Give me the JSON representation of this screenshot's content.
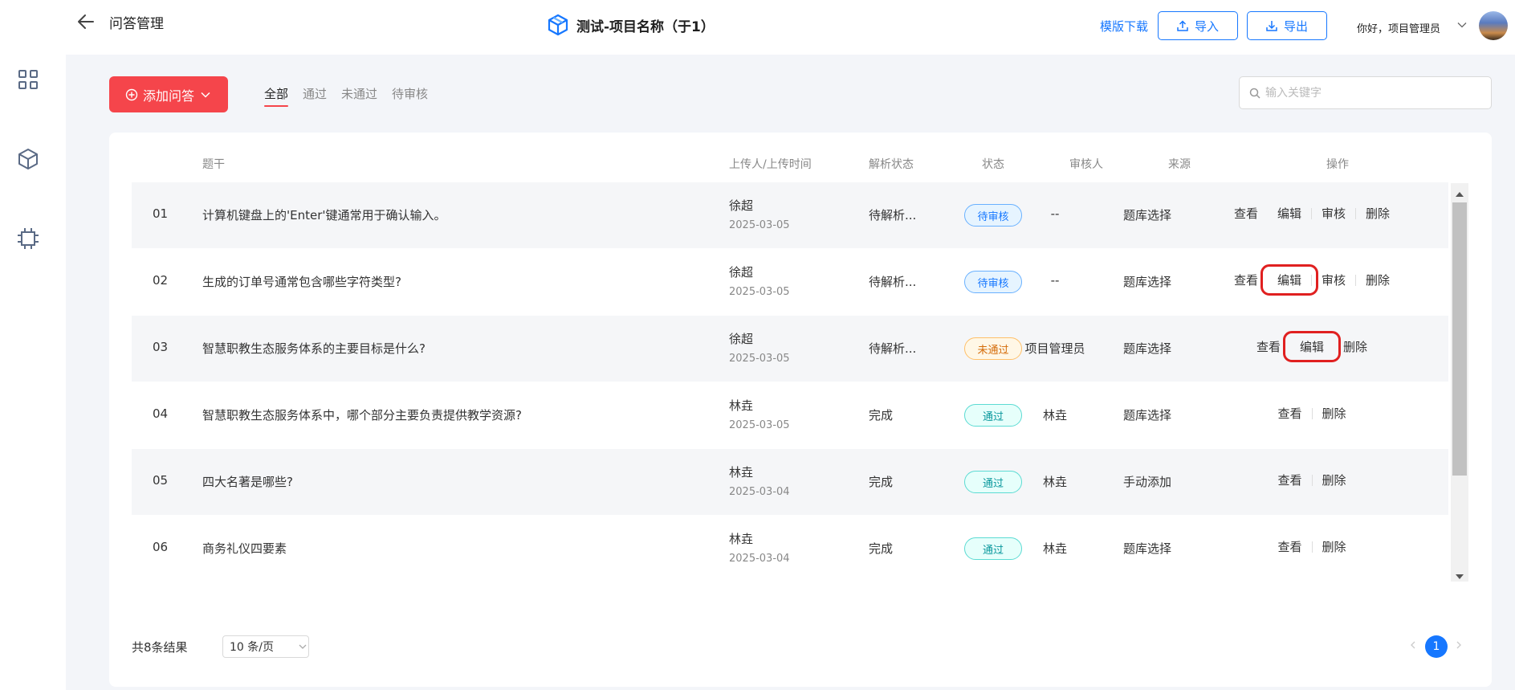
{
  "header": {
    "page_title": "问答管理",
    "project_name": "测试-项目名称（于1）",
    "template_download": "模版下载",
    "import_label": "导入",
    "export_label": "导出",
    "greeting": "你好，项目管理员"
  },
  "toolbar": {
    "add_label": "添加问答",
    "tabs": [
      "全部",
      "通过",
      "未通过",
      "待审核"
    ],
    "active_tab": "全部",
    "search_placeholder": "输入关键字"
  },
  "table": {
    "headers": {
      "question": "题干",
      "uploader": "上传人/上传时间",
      "parse_status": "解析状态",
      "status": "状态",
      "reviewer": "审核人",
      "source": "来源",
      "actions": "操作"
    },
    "rows": [
      {
        "num": "01",
        "question": "计算机键盘上的'Enter'键通常用于确认输入。",
        "uploader": "徐超",
        "date": "2025-03-05",
        "parse": "待解析...",
        "status": "待审核",
        "reviewer": "--",
        "source": "题库选择",
        "actions": [
          "查看",
          "编辑",
          "审核",
          "删除"
        ]
      },
      {
        "num": "02",
        "question": "生成的订单号通常包含哪些字符类型?",
        "uploader": "徐超",
        "date": "2025-03-05",
        "parse": "待解析...",
        "status": "待审核",
        "reviewer": "--",
        "source": "题库选择",
        "actions": [
          "查看",
          "编辑",
          "审核",
          "删除"
        ]
      },
      {
        "num": "03",
        "question": "智慧职教生态服务体系的主要目标是什么?",
        "uploader": "徐超",
        "date": "2025-03-05",
        "parse": "待解析...",
        "status": "未通过",
        "reviewer": "项目管理员",
        "source": "题库选择",
        "actions": [
          "查看",
          "编辑",
          "删除"
        ]
      },
      {
        "num": "04",
        "question": "智慧职教生态服务体系中，哪个部分主要负责提供教学资源?",
        "uploader": "林垚",
        "date": "2025-03-05",
        "parse": "完成",
        "status": "通过",
        "reviewer": "林垚",
        "source": "题库选择",
        "actions": [
          "查看",
          "删除"
        ]
      },
      {
        "num": "05",
        "question": "四大名著是哪些?",
        "uploader": "林垚",
        "date": "2025-03-04",
        "parse": "完成",
        "status": "通过",
        "reviewer": "林垚",
        "source": "手动添加",
        "actions": [
          "查看",
          "删除"
        ]
      },
      {
        "num": "06",
        "question": "商务礼仪四要素",
        "uploader": "林垚",
        "date": "2025-03-04",
        "parse": "完成",
        "status": "通过",
        "reviewer": "林垚",
        "source": "题库选择",
        "actions": [
          "查看",
          "删除"
        ]
      }
    ]
  },
  "footer": {
    "total": "共8条结果",
    "page_size": "10 条/页",
    "current_page": "1"
  },
  "colors": {
    "primary": "#1677ff",
    "danger": "#f5454b",
    "highlight": "#e02020"
  }
}
